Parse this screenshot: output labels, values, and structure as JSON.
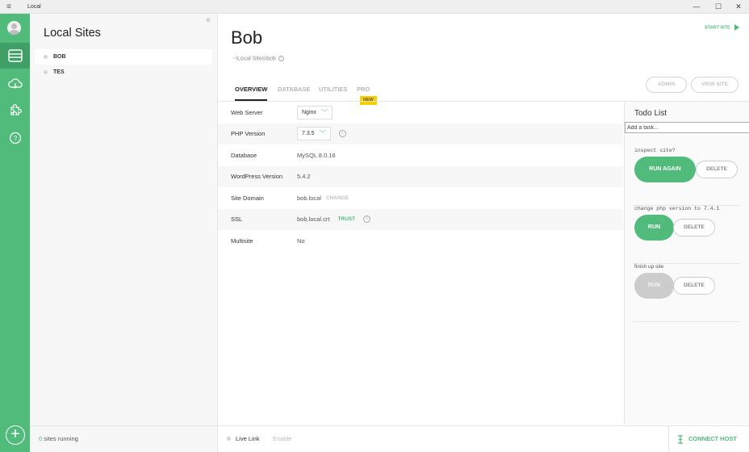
{
  "window": {
    "menu_icon": "hamburger-icon",
    "title": "Local"
  },
  "rail": {
    "icons": [
      "avatar",
      "sites-icon",
      "cloud-icon",
      "addons-puzzle-icon",
      "help-icon",
      "add-icon"
    ],
    "accent": "#51bb7b"
  },
  "sites_panel": {
    "heading": "Local Sites",
    "items": [
      {
        "label": "BOB",
        "selected": true
      },
      {
        "label": "TES",
        "selected": false
      }
    ],
    "footer": {
      "count": "0",
      "suffix": " sites running"
    }
  },
  "site": {
    "name": "Bob",
    "path": "~\\Local Sites\\bob",
    "start_label": "START SITE"
  },
  "tabs": [
    {
      "label": "OVERVIEW",
      "active": true
    },
    {
      "label": "DATABASE",
      "active": false
    },
    {
      "label": "UTILITIES",
      "active": false
    },
    {
      "label": "PRO",
      "active": false,
      "badge": "NEW"
    }
  ],
  "header_buttons": {
    "admin": "ADMIN",
    "view_site": "VIEW SITE"
  },
  "overview": {
    "web_server": {
      "label": "Web Server",
      "value": "Nginx"
    },
    "php_version": {
      "label": "PHP Version",
      "value": "7.3.5"
    },
    "database": {
      "label": "Database",
      "value": "MySQL 8.0.16"
    },
    "wordpress_version": {
      "label": "WordPress Version",
      "value": "5.4.2"
    },
    "site_domain": {
      "label": "Site Domain",
      "value": "bob.local",
      "action": "CHANGE"
    },
    "ssl": {
      "label": "SSL",
      "value": "bob.local.crt",
      "action": "TRUST"
    },
    "multisite": {
      "label": "Multisite",
      "value": "No"
    }
  },
  "todo": {
    "title": "Todo List",
    "input_value": "Add a task...",
    "tasks": [
      {
        "name": "inspect site?",
        "run_label": "RUN AGAIN",
        "delete_label": "DELETE"
      },
      {
        "name": "change php version to 7.4.1",
        "run_label": "RUN",
        "delete_label": "DELETE"
      },
      {
        "name": "finish up site",
        "run_label": "RUN",
        "run_disabled": true,
        "delete_label": "DELETE"
      }
    ]
  },
  "bottom": {
    "live_link": "Live Link",
    "enable": "Enable",
    "connect_host": "CONNECT HOST"
  }
}
